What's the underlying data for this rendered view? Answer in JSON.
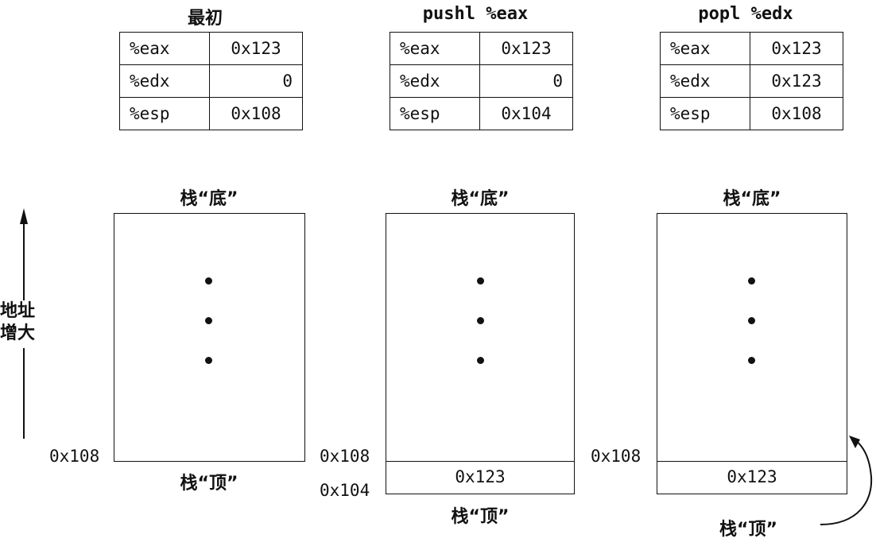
{
  "panels": [
    {
      "title": "最初",
      "registers": [
        {
          "name": "%eax",
          "value": "0x123"
        },
        {
          "name": "%edx",
          "value": "0"
        },
        {
          "name": "%esp",
          "value": "0x108"
        }
      ],
      "stack_bottom_label": "栈“底”",
      "stack_top_label": "栈“顶”",
      "addresses": [
        "0x108"
      ],
      "cells": []
    },
    {
      "title": "pushl %eax",
      "registers": [
        {
          "name": "%eax",
          "value": "0x123"
        },
        {
          "name": "%edx",
          "value": "0"
        },
        {
          "name": "%esp",
          "value": "0x104"
        }
      ],
      "stack_bottom_label": "栈“底”",
      "stack_top_label": "栈“顶”",
      "addresses": [
        "0x108",
        "0x104"
      ],
      "cells": [
        "0x123"
      ]
    },
    {
      "title": "popl %edx",
      "registers": [
        {
          "name": "%eax",
          "value": "0x123"
        },
        {
          "name": "%edx",
          "value": "0x123"
        },
        {
          "name": "%esp",
          "value": "0x108"
        }
      ],
      "stack_bottom_label": "栈“底”",
      "stack_top_label": "栈“顶”",
      "addresses": [
        "0x108"
      ],
      "cells": [
        "0x123"
      ]
    }
  ],
  "axis_label": [
    "地址",
    "增大"
  ]
}
